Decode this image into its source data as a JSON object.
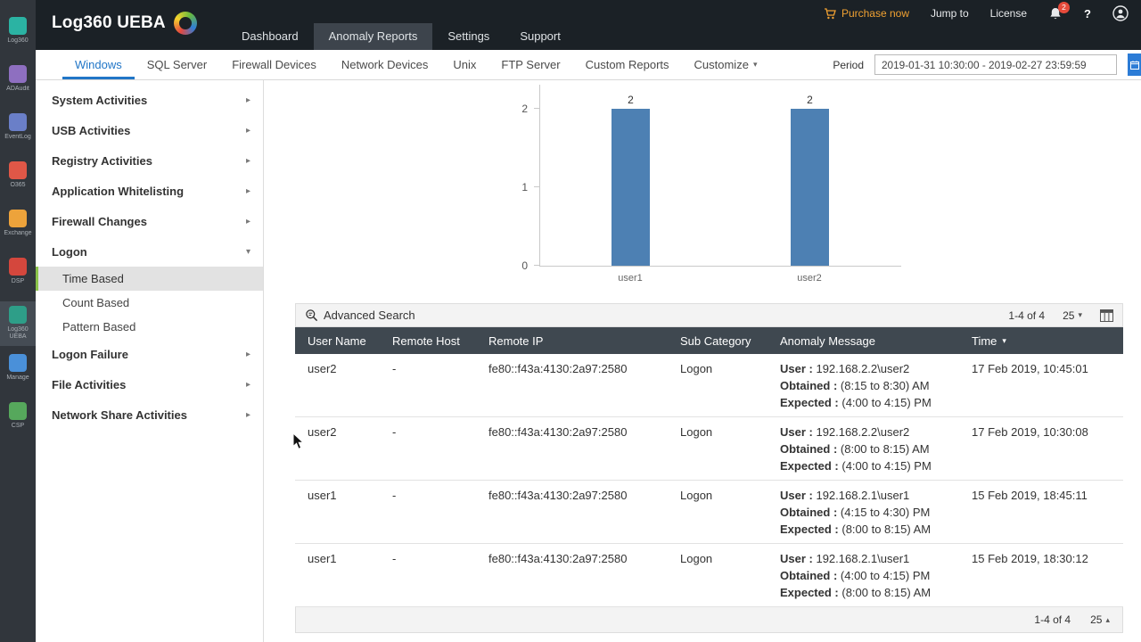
{
  "colors": {
    "accent_blue": "#2176c7",
    "bar_blue": "#4d80b3",
    "table_header_slate": "#3f4850",
    "purchase_orange": "#f0a132",
    "badge_red": "#e64a3b",
    "selected_green": "#8bc34a"
  },
  "app_rail": {
    "items": [
      {
        "label": "Log360",
        "color": "#2bb3a3"
      },
      {
        "label": "ADAudit",
        "color": "#8e6fc0"
      },
      {
        "label": "EventLog",
        "color": "#6a7fc8"
      },
      {
        "label": "O365",
        "color": "#e05747"
      },
      {
        "label": "Exchange",
        "color": "#eda33b"
      },
      {
        "label": "DSP",
        "color": "#d4473d"
      },
      {
        "label": "Log360 UEBA",
        "color": "#2e9e88"
      },
      {
        "label": "Manage",
        "color": "#4a90d9"
      },
      {
        "label": "CSP",
        "color": "#56a85c"
      }
    ]
  },
  "topbar": {
    "logo": "Log360 UEBA",
    "nav": [
      {
        "label": "Dashboard"
      },
      {
        "label": "Anomaly Reports"
      },
      {
        "label": "Settings"
      },
      {
        "label": "Support"
      }
    ],
    "purchase_now": "Purchase now",
    "jump_to": "Jump to",
    "license": "License",
    "notification_count": "2",
    "help": "?"
  },
  "subnav": {
    "tabs": [
      {
        "label": "Windows"
      },
      {
        "label": "SQL Server"
      },
      {
        "label": "Firewall Devices"
      },
      {
        "label": "Network Devices"
      },
      {
        "label": "Unix"
      },
      {
        "label": "FTP Server"
      },
      {
        "label": "Custom Reports"
      },
      {
        "label": "Customize",
        "caret": "▾"
      }
    ],
    "period_label": "Period",
    "period_value": "2019-01-31 10:30:00 - 2019-02-27 23:59:59"
  },
  "sidebar": {
    "items": [
      {
        "label": "System Activities",
        "chevron": "▸"
      },
      {
        "label": "USB Activities",
        "chevron": "▸"
      },
      {
        "label": "Registry Activities",
        "chevron": "▸"
      },
      {
        "label": "Application Whitelisting",
        "chevron": "▸"
      },
      {
        "label": "Firewall Changes",
        "chevron": "▸"
      },
      {
        "label": "Logon",
        "chevron": "▾"
      },
      {
        "label": "Logon Failure",
        "chevron": "▸"
      },
      {
        "label": "File Activities",
        "chevron": "▸"
      },
      {
        "label": "Network Share Activities",
        "chevron": "▸"
      }
    ],
    "logon_children": [
      {
        "label": "Time Based"
      },
      {
        "label": "Count Based"
      },
      {
        "label": "Pattern Based"
      }
    ]
  },
  "chart_data": {
    "type": "bar",
    "title": "",
    "categories": [
      "user1",
      "user2"
    ],
    "values": [
      2,
      2
    ],
    "value_labels": [
      "2",
      "2"
    ],
    "yticks_top_down": [
      "2",
      "1",
      "0"
    ],
    "ylim": [
      0,
      2
    ],
    "bar_color": "#4d80b3",
    "grid": false,
    "legend": "none"
  },
  "table": {
    "toolbar": {
      "search_label": "Advanced Search",
      "range": "1-4 of 4",
      "page_size": "25"
    },
    "columns": [
      "User Name",
      "Remote Host",
      "Remote IP",
      "Sub Category",
      "Anomaly Message",
      "Time"
    ],
    "sort_column": "Time",
    "rows": [
      {
        "user_name": "user2",
        "remote_host": "-",
        "remote_ip": "fe80::f43a:4130:2a97:2580",
        "sub_category": "Logon",
        "msg": [
          {
            "k": "User :",
            "v": " 192.168.2.2\\user2"
          },
          {
            "k": "Obtained :",
            "v": " (8:15 to 8:30) AM"
          },
          {
            "k": "Expected :",
            "v": " (4:00 to 4:15) PM"
          }
        ],
        "time": "17 Feb 2019, 10:45:01"
      },
      {
        "user_name": "user2",
        "remote_host": "-",
        "remote_ip": "fe80::f43a:4130:2a97:2580",
        "sub_category": "Logon",
        "msg": [
          {
            "k": "User :",
            "v": " 192.168.2.2\\user2"
          },
          {
            "k": "Obtained :",
            "v": " (8:00 to 8:15) AM"
          },
          {
            "k": "Expected :",
            "v": " (4:00 to 4:15) PM"
          }
        ],
        "time": "17 Feb 2019, 10:30:08"
      },
      {
        "user_name": "user1",
        "remote_host": "-",
        "remote_ip": "fe80::f43a:4130:2a97:2580",
        "sub_category": "Logon",
        "msg": [
          {
            "k": "User :",
            "v": " 192.168.2.1\\user1"
          },
          {
            "k": "Obtained :",
            "v": " (4:15 to 4:30) PM"
          },
          {
            "k": "Expected :",
            "v": " (8:00 to 8:15) AM"
          }
        ],
        "time": "15 Feb 2019, 18:45:11"
      },
      {
        "user_name": "user1",
        "remote_host": "-",
        "remote_ip": "fe80::f43a:4130:2a97:2580",
        "sub_category": "Logon",
        "msg": [
          {
            "k": "User :",
            "v": " 192.168.2.1\\user1"
          },
          {
            "k": "Obtained :",
            "v": " (4:00 to 4:15) PM"
          },
          {
            "k": "Expected :",
            "v": " (8:00 to 8:15) AM"
          }
        ],
        "time": "15 Feb 2019, 18:30:12"
      }
    ],
    "footer": {
      "range": "1-4 of 4",
      "page_size": "25"
    }
  }
}
